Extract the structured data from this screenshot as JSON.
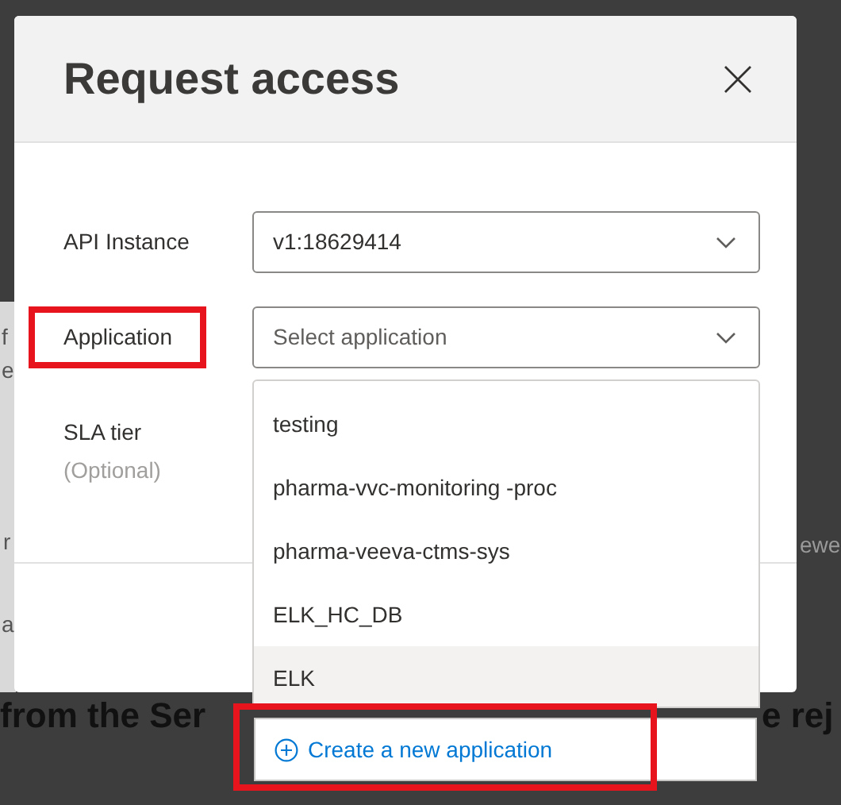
{
  "background": {
    "fragments": [
      {
        "text": "f"
      },
      {
        "text": "e"
      },
      {
        "text": "r"
      },
      {
        "text": "a"
      },
      {
        "text": "ewe"
      },
      {
        "text": "from the Ser",
        "kind": "heading"
      },
      {
        "text": "e rej",
        "kind": "heading"
      }
    ]
  },
  "dialog": {
    "title": "Request access",
    "fields": [
      {
        "label": "API Instance",
        "kind": "select",
        "value": "v1:18629414",
        "highlighted": false
      },
      {
        "label": "Application",
        "kind": "select",
        "placeholder": "Select application",
        "highlighted": true
      },
      {
        "label": "SLA tier",
        "kind": "label",
        "hint": "(Optional)",
        "highlighted": false
      }
    ]
  },
  "dropdown": {
    "options": [
      {
        "label": "testing",
        "selected": false
      },
      {
        "label": "pharma-vvc-monitoring -proc",
        "selected": false
      },
      {
        "label": "pharma-veeva-ctms-sys",
        "selected": false
      },
      {
        "label": "ELK_HC_DB",
        "selected": false
      },
      {
        "label": "ELK",
        "selected": true
      }
    ],
    "create_button": {
      "label": "Create a new application",
      "highlighted": true
    }
  }
}
